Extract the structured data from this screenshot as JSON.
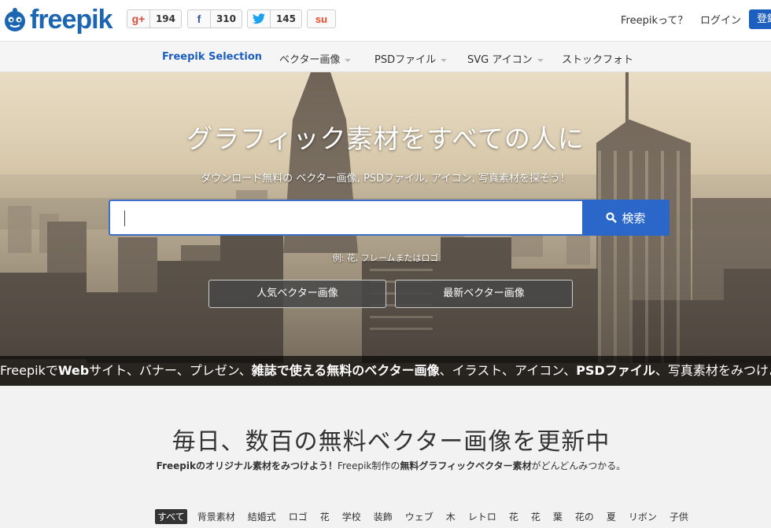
{
  "header": {
    "logo_text": "freepik",
    "share": [
      {
        "icon": "google-plus-icon",
        "glyph": "g+",
        "count": "194",
        "color": "#dd4b39"
      },
      {
        "icon": "facebook-icon",
        "glyph": "f",
        "count": "310",
        "color": "#3b5998"
      },
      {
        "icon": "twitter-icon",
        "glyph": "t",
        "count": "145",
        "color": "#1da1f2"
      },
      {
        "icon": "stumbleupon-icon",
        "glyph": "su",
        "count": "",
        "color": "#eb4924"
      }
    ],
    "about_link": "Freepikって？",
    "login_link": "ログイン",
    "register_button": "登録"
  },
  "nav": {
    "items": [
      {
        "label": "Freepik Selection"
      },
      {
        "label": "ベクター画像"
      },
      {
        "label": "PSDファイル"
      },
      {
        "label": "SVG アイコン"
      },
      {
        "label": "ストックフォト"
      }
    ]
  },
  "hero": {
    "title": "グラフィック素材をすべての人に",
    "subtitle": "ダウンロード無料の ベクター画像, PSDファイル, アイコン, 写真素材を探そう！",
    "search": {
      "value": "",
      "placeholder": "",
      "button_label": "検索"
    },
    "example": "例: 花, フレームまたはロゴ",
    "buttons": [
      "人気ベクター画像",
      "最新ベクター画像"
    ],
    "ticker": {
      "part1": "Freepikで",
      "part2": "Web",
      "part3": "サイト、バナー、プレゼン、",
      "part4": "雑誌で使える無料のベクター画像",
      "part5": "、イラスト、アイコン、",
      "part6": "PSDファイル",
      "part7": "、写真素材をみつけよう"
    }
  },
  "main": {
    "title": "毎日、数百の無料ベクター画像を更新中",
    "sub_part1": "Freepikのオリジナル素材をみつけよう！",
    "sub_part2": "Freepik制作の",
    "sub_part3": "無料グラフィックベクター素材",
    "sub_part4": "がどんどんみつかる。",
    "tags": [
      "すべて",
      "背景素材",
      "結婚式",
      "ロゴ",
      "花",
      "学校",
      "装飾",
      "ウェブ",
      "木",
      "レトロ",
      "花",
      "花",
      "葉",
      "花の",
      "夏",
      "リボン",
      "子供"
    ]
  },
  "colors": {
    "brand": "#1b65b2",
    "search_button": "#2a67c9",
    "register": "#1d5fbf"
  }
}
